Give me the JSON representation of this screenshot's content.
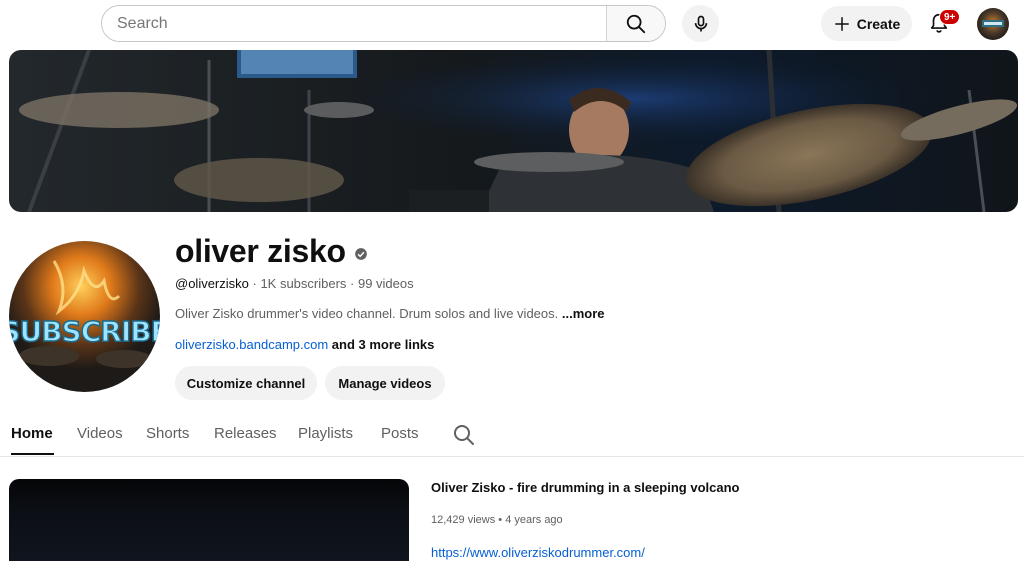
{
  "topbar": {
    "search_placeholder": "Search",
    "create_label": "Create",
    "notification_count": "9+"
  },
  "icons": {
    "search": "search-icon",
    "mic": "microphone-icon",
    "create": "plus-icon",
    "bell": "bell-icon",
    "verified": "verified-icon"
  },
  "channel": {
    "name": "oliver zisko",
    "handle": "@oliverzisko",
    "stats": " · 1K subscribers · 99 videos",
    "description": "Oliver Zisko drummer's video channel. Drum solos and live videos. ",
    "description_more": "...more",
    "link": "oliverzisko.bandcamp.com",
    "more_links": " and 3 more links",
    "avatar_text": "SUBSCRIBE",
    "customize_label": "Customize channel",
    "manage_label": "Manage videos"
  },
  "tabs": [
    "Home",
    "Videos",
    "Shorts",
    "Releases",
    "Playlists",
    "Posts"
  ],
  "active_tab": "Home",
  "featured_video": {
    "title": "Oliver Zisko - fire drumming in a sleeping volcano",
    "views": "12,429 views",
    "age": "4 years ago",
    "link": "https://www.oliverziskodrummer.com/"
  },
  "colors": {
    "accent_link": "#065fd4",
    "badge_red": "#cc0000",
    "pill_bg": "#f2f2f2",
    "text_primary": "#0f0f0f",
    "text_secondary": "#606060"
  }
}
